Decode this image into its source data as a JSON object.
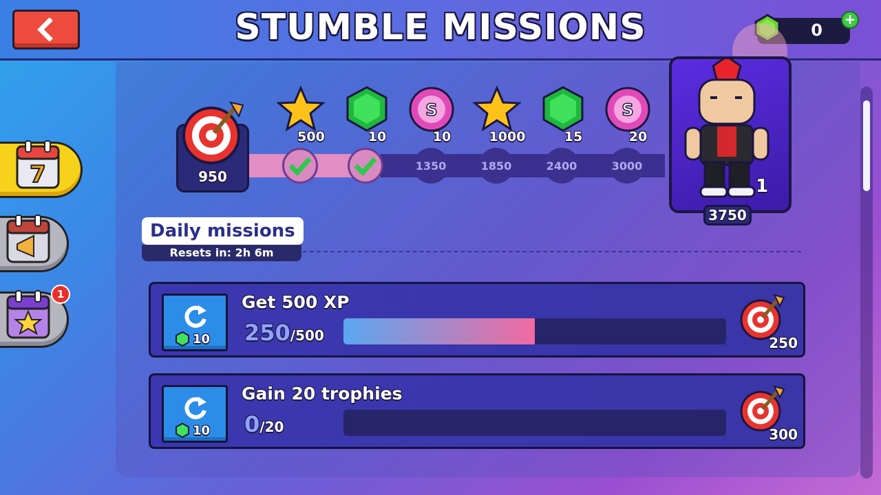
{
  "header": {
    "title": "STUMBLE MISSIONS",
    "back_icon": "arrow-left-icon",
    "gem_count": "0",
    "add_icon": "plus-icon"
  },
  "tabs": [
    {
      "icon": "calendar-7-icon",
      "active": true
    },
    {
      "icon": "calendar-megaphone-icon",
      "active": false
    },
    {
      "icon": "calendar-star-icon",
      "active": false,
      "badge": "1"
    }
  ],
  "pass": {
    "current_points": "950",
    "rewards": [
      {
        "type": "star",
        "amount": "500",
        "threshold": "",
        "claimed": true
      },
      {
        "type": "gem",
        "amount": "10",
        "threshold": "",
        "claimed": true
      },
      {
        "type": "skill-coin",
        "amount": "10",
        "threshold": "1350",
        "claimed": false
      },
      {
        "type": "star",
        "amount": "1000",
        "threshold": "1850",
        "claimed": false
      },
      {
        "type": "gem",
        "amount": "15",
        "threshold": "2400",
        "claimed": false
      },
      {
        "type": "skill-coin",
        "amount": "20",
        "threshold": "3000",
        "claimed": false
      }
    ],
    "final_reward": {
      "character": "punk-mohawk-skin",
      "count": "1",
      "threshold": "3750"
    }
  },
  "daily": {
    "title": "Daily missions",
    "resets_label": "Resets in:",
    "resets_value": "2h 6m"
  },
  "missions": [
    {
      "title": "Get 500 XP",
      "current": "250",
      "target": "/500",
      "progress": 0.5,
      "reroll_cost": "10",
      "reward": "250"
    },
    {
      "title": "Gain 20 trophies",
      "current": "0",
      "target": "/20",
      "progress": 0.0,
      "reroll_cost": "10",
      "reward": "300"
    }
  ],
  "colors": {
    "accent_red": "#ee4b3f",
    "gem_green": "#2fd14a",
    "star_yellow": "#ffc21a",
    "coin_pink": "#e04ab8",
    "bar_start": "#5aa6f0",
    "bar_end": "#f16aa0"
  }
}
